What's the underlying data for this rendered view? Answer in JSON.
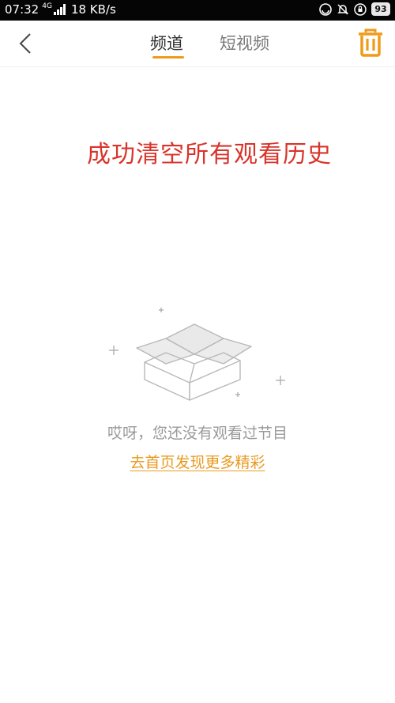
{
  "status_bar": {
    "time": "07:32",
    "network_type": "4G",
    "speed": "18 KB/s",
    "battery": "93"
  },
  "header": {
    "tabs": [
      {
        "label": "频道",
        "active": true
      },
      {
        "label": "短视频",
        "active": false
      }
    ],
    "accent_color": "#f09a1a"
  },
  "content": {
    "success_message": "成功清空所有观看历史",
    "success_color": "#d9342b",
    "empty_text": "哎呀，您还没有观看过节目",
    "home_link": "去首页发现更多精彩",
    "link_color": "#e89a20"
  },
  "icons": {
    "back": "chevron-left-icon",
    "trash": "trash-icon",
    "empty_box": "open-box-icon"
  }
}
